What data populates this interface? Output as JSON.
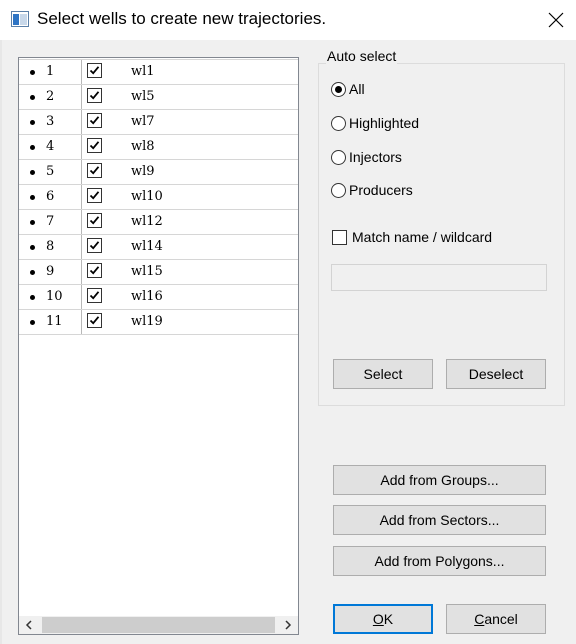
{
  "window": {
    "title": "Select wells to create new trajectories.",
    "app_icon": "window-app-icon",
    "close_icon": "close-icon"
  },
  "wells": [
    {
      "num": "1",
      "name": "wl1",
      "checked": true
    },
    {
      "num": "2",
      "name": "wl5",
      "checked": true
    },
    {
      "num": "3",
      "name": "wl7",
      "checked": true
    },
    {
      "num": "4",
      "name": "wl8",
      "checked": true
    },
    {
      "num": "5",
      "name": "wl9",
      "checked": true
    },
    {
      "num": "6",
      "name": "wl10",
      "checked": true
    },
    {
      "num": "7",
      "name": "wl12",
      "checked": true
    },
    {
      "num": "8",
      "name": "wl14",
      "checked": true
    },
    {
      "num": "9",
      "name": "wl15",
      "checked": true
    },
    {
      "num": "10",
      "name": "wl16",
      "checked": true
    },
    {
      "num": "11",
      "name": "wl19",
      "checked": true
    }
  ],
  "auto_select": {
    "label": "Auto select",
    "options": [
      {
        "label": "All",
        "selected": true
      },
      {
        "label": "Highlighted",
        "selected": false
      },
      {
        "label": "Injectors",
        "selected": false
      },
      {
        "label": "Producers",
        "selected": false
      }
    ],
    "match_label": "Match name / wildcard",
    "match_checked": false,
    "match_value": "",
    "select_label": "Select",
    "deselect_label": "Deselect"
  },
  "buttons": {
    "add_groups": "Add from Groups...",
    "add_sectors": "Add from Sectors...",
    "add_polygons": "Add from Polygons...",
    "ok": "OK",
    "cancel": "Cancel"
  },
  "colors": {
    "accent": "#0078d7",
    "button_face": "#e1e1e1",
    "dialog_bg": "#f0f0f0"
  }
}
